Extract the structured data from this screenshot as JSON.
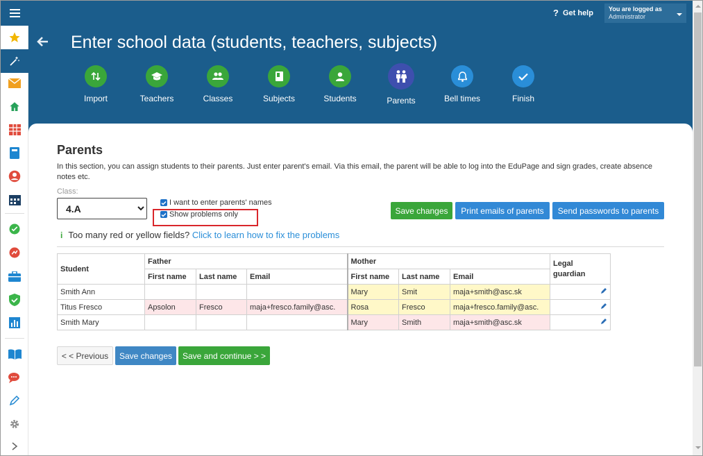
{
  "topbar": {
    "help_label": "Get help",
    "user_line1": "You are logged as",
    "user_line2": "Administrator"
  },
  "sidebar": {
    "items": [
      "star-icon",
      "wizard-icon",
      "mail-icon",
      "home-icon",
      "timetable-icon",
      "book-icon",
      "user-icon",
      "calendar-icon",
      "check-icon",
      "progress-icon",
      "briefcase-icon",
      "shield-icon",
      "chart-icon",
      "open-book-icon",
      "chat-icon",
      "pen-icon",
      "gear-icon",
      "chevron-right-icon"
    ]
  },
  "header": {
    "title": "Enter school data (students, teachers, subjects)"
  },
  "steps": [
    {
      "label": "Import",
      "state": "done",
      "icon": "import-icon"
    },
    {
      "label": "Teachers",
      "state": "done",
      "icon": "graduation-cap-icon"
    },
    {
      "label": "Classes",
      "state": "done",
      "icon": "group-icon"
    },
    {
      "label": "Subjects",
      "state": "done",
      "icon": "book-icon"
    },
    {
      "label": "Students",
      "state": "done",
      "icon": "person-icon"
    },
    {
      "label": "Parents",
      "state": "current",
      "icon": "parents-icon"
    },
    {
      "label": "Bell times",
      "state": "todo",
      "icon": "bell-icon"
    },
    {
      "label": "Finish",
      "state": "todo",
      "icon": "checkmark-icon"
    }
  ],
  "section": {
    "title": "Parents",
    "description": "In this section, you can assign students to their parents. Just enter parent's email. Via this email, the parent will be able to log into the EduPage and sign grades, create absence notes etc."
  },
  "class_filter": {
    "label": "Class:",
    "selected": "4.A"
  },
  "options": {
    "names_label": "I want to enter parents' names",
    "problems_label": "Show problems only"
  },
  "actions": {
    "save_changes": "Save changes",
    "print_emails": "Print emails of parents",
    "send_passwords": "Send passwords to parents"
  },
  "info": {
    "text": "Too many red or yellow fields?",
    "link": "Click to learn how to fix the problems"
  },
  "table": {
    "student_header": "Student",
    "father_header": "Father",
    "mother_header": "Mother",
    "guardian_header_1": "Legal",
    "guardian_header_2": "guardian",
    "first_name": "First name",
    "last_name": "Last name",
    "email": "Email",
    "rows": [
      {
        "student": "Smith Ann",
        "f_first": "",
        "f_last": "",
        "f_email": "",
        "m_first": "Mary",
        "m_last": "Smit",
        "m_email": "maja+smith@asc.sk"
      },
      {
        "student": "Titus Fresco",
        "f_first": "Apsolon",
        "f_last": "Fresco",
        "f_email": "maja+fresco.family@asc.",
        "m_first": "Rosa",
        "m_last": "Fresco",
        "m_email": "maja+fresco.family@asc."
      },
      {
        "student": "Smith Mary",
        "f_first": "",
        "f_last": "",
        "f_email": "",
        "m_first": "Mary",
        "m_last": "Smith",
        "m_email": "maja+smith@asc.sk"
      }
    ]
  },
  "footer": {
    "previous": "< < Previous",
    "save_changes": "Save changes",
    "save_continue": "Save and continue > >"
  },
  "colors": {
    "header_blue": "#1b5d8c",
    "done_green": "#3aa63a",
    "current_indigo": "#3e4fae",
    "todo_blue": "#2a8ed8",
    "highlight_red": "#d9262b",
    "warn_yellow": "#fff8c8",
    "warn_pink": "#fde6e8"
  }
}
